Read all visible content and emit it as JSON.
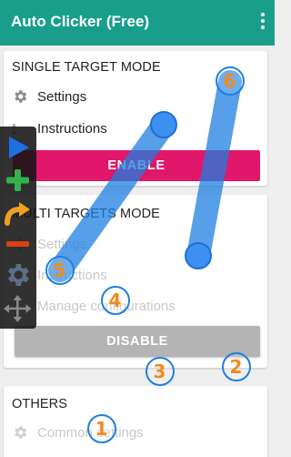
{
  "appbar": {
    "title": "Auto Clicker (Free)",
    "menu_icon": "more-vert-icon"
  },
  "single_target": {
    "title": "SINGLE TARGET MODE",
    "settings_label": "Settings",
    "instructions_label": "Instructions",
    "info_glyph": "i",
    "enable_label": "ENABLE"
  },
  "multi_target": {
    "title": "MULTI TARGETS MODE",
    "settings_label": "Settings",
    "instructions_label": "Instructions",
    "manage_label": "Manage configurations",
    "disable_label": "DISABLE"
  },
  "others": {
    "title": "OTHERS",
    "common_settings_label": "Common settings"
  },
  "panel": {
    "buttons": [
      "play-icon",
      "add-icon",
      "redo-icon",
      "remove-icon",
      "gear-icon",
      "move-icon"
    ]
  },
  "targets": [
    {
      "label": "1"
    },
    {
      "label": "2"
    },
    {
      "label": "3"
    },
    {
      "label": "4"
    },
    {
      "label": "5"
    },
    {
      "label": "6"
    }
  ],
  "colors": {
    "appbar": "#1a9e8c",
    "enable": "#e0176a",
    "disable": "#b4b4b4",
    "swipe": "#1f7fe0",
    "target_number": "#f08b1f",
    "play": "#1f6fe0",
    "add": "#2fb34a",
    "redo": "#f0a020",
    "remove": "#d84315"
  }
}
